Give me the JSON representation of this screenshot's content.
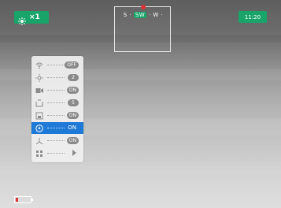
{
  "status": {
    "mode_icon": "sun-icon",
    "zoom": "×1",
    "time": "11:20"
  },
  "compass": {
    "left": "S ·",
    "active": "SW",
    "right": "· W ·"
  },
  "menu": {
    "items": [
      {
        "icon": "wifi-icon",
        "value": "OFF",
        "selected": false
      },
      {
        "icon": "brightness-icon",
        "value": "2",
        "selected": false
      },
      {
        "icon": "recording-icon",
        "value": "ON",
        "selected": false
      },
      {
        "icon": "frame-icon",
        "value": "5",
        "selected": false
      },
      {
        "icon": "storage-icon",
        "value": "ON",
        "selected": false
      },
      {
        "icon": "compass-icon",
        "value": "ON",
        "selected": true
      },
      {
        "icon": "gyro-icon",
        "value": "ON",
        "selected": false
      },
      {
        "icon": "settings-grid-icon",
        "value": "",
        "selected": false
      }
    ]
  },
  "battery": {
    "level": 0.15,
    "color": "#e03232"
  },
  "colors": {
    "accent": "#19a56a",
    "selection": "#1f79d6"
  }
}
